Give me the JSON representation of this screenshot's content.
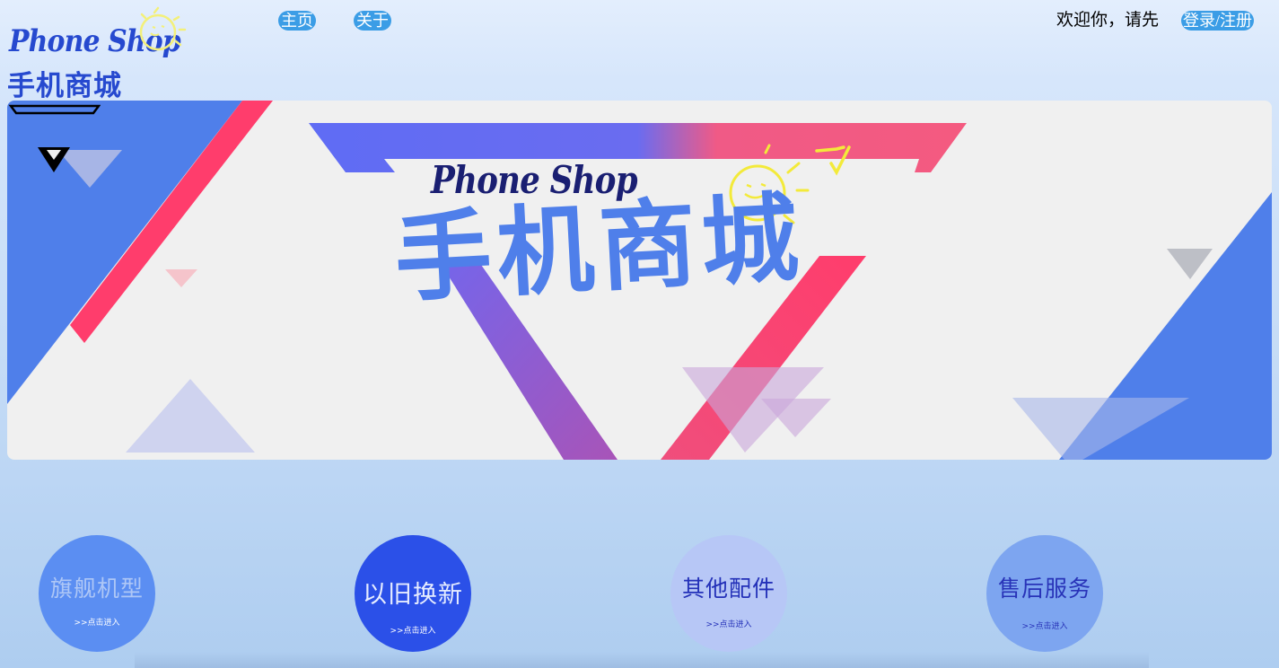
{
  "header": {
    "logo": {
      "text_en": "Phone Shop",
      "text_cn": "手机商城",
      "icon": "sun-smiley-icon"
    },
    "nav": [
      {
        "label": "主页"
      },
      {
        "label": "关于"
      }
    ],
    "welcome_text": "欢迎你，请先",
    "login_label": "登录/注册"
  },
  "banner": {
    "title_en": "Phone Shop",
    "title_cn": "手机商城",
    "menu_icon": "hamburger-chevron-icon",
    "colors": {
      "blue": "#4f7fea",
      "pink": "#ff3d6c",
      "purple": "#6a6cf0",
      "background": "#f0f0f0"
    }
  },
  "categories": [
    {
      "title": "旗舰机型",
      "enter": ">>点击进入",
      "color": "#5b8ef2"
    },
    {
      "title": "以旧换新",
      "enter": ">>点击进入",
      "color": "#2b50e8"
    },
    {
      "title": "其他配件",
      "enter": ">>点击进入",
      "color": "#b7c7f6"
    },
    {
      "title": "售后服务",
      "enter": ">>点击进入",
      "color": "#7da5f0"
    }
  ]
}
